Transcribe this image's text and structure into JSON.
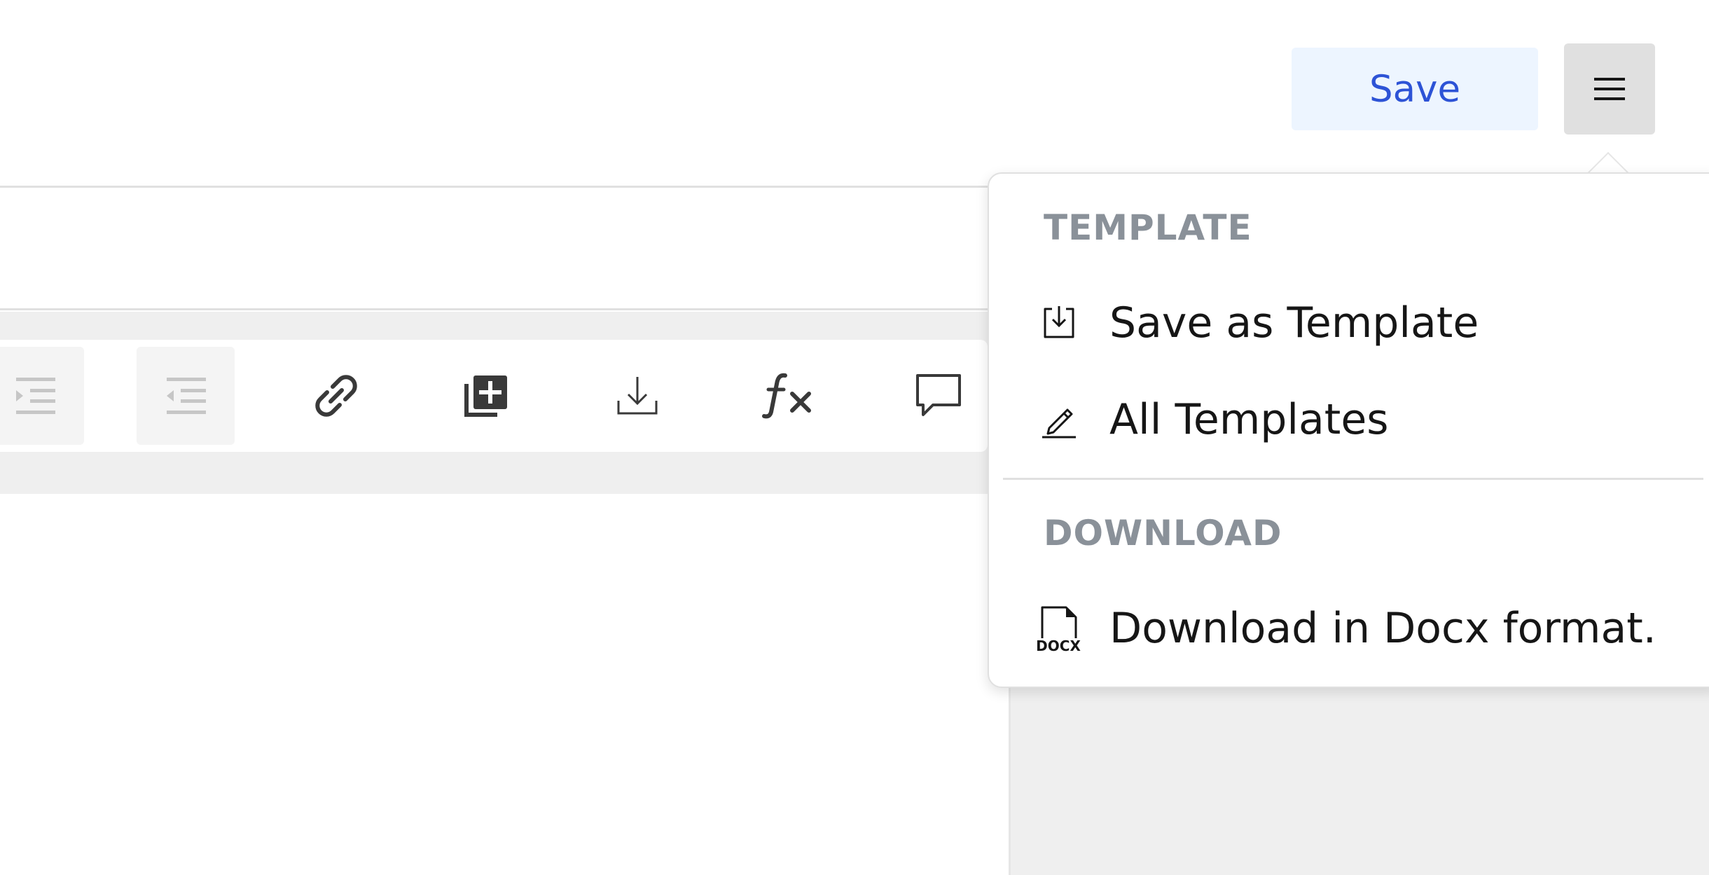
{
  "header": {
    "save_label": "Save",
    "menu_icon": "hamburger-menu-icon"
  },
  "toolbar": {
    "tools": [
      {
        "name": "indent-icon",
        "state": "disabled"
      },
      {
        "name": "outdent-icon",
        "state": "disabled"
      },
      {
        "name": "link-icon",
        "state": "enabled"
      },
      {
        "name": "add-block-icon",
        "state": "enabled"
      },
      {
        "name": "download-icon",
        "state": "enabled"
      },
      {
        "name": "formula-icon",
        "state": "enabled"
      },
      {
        "name": "comment-icon",
        "state": "enabled"
      }
    ]
  },
  "dropdown": {
    "sections": [
      {
        "title": "TEMPLATE",
        "items": [
          {
            "label": "Save as Template",
            "icon": "save-template-icon"
          },
          {
            "label": "All Templates",
            "icon": "pencil-icon"
          }
        ]
      },
      {
        "title": "DOWNLOAD",
        "items": [
          {
            "label": "Download in Docx format.",
            "icon": "docx-file-icon"
          }
        ]
      }
    ]
  },
  "colors": {
    "accent": "#2d53d6",
    "save_bg": "#edf5ff",
    "menu_btn_bg": "#e0e0e0",
    "section_title": "#8a9199",
    "band_bg": "#efefef"
  }
}
